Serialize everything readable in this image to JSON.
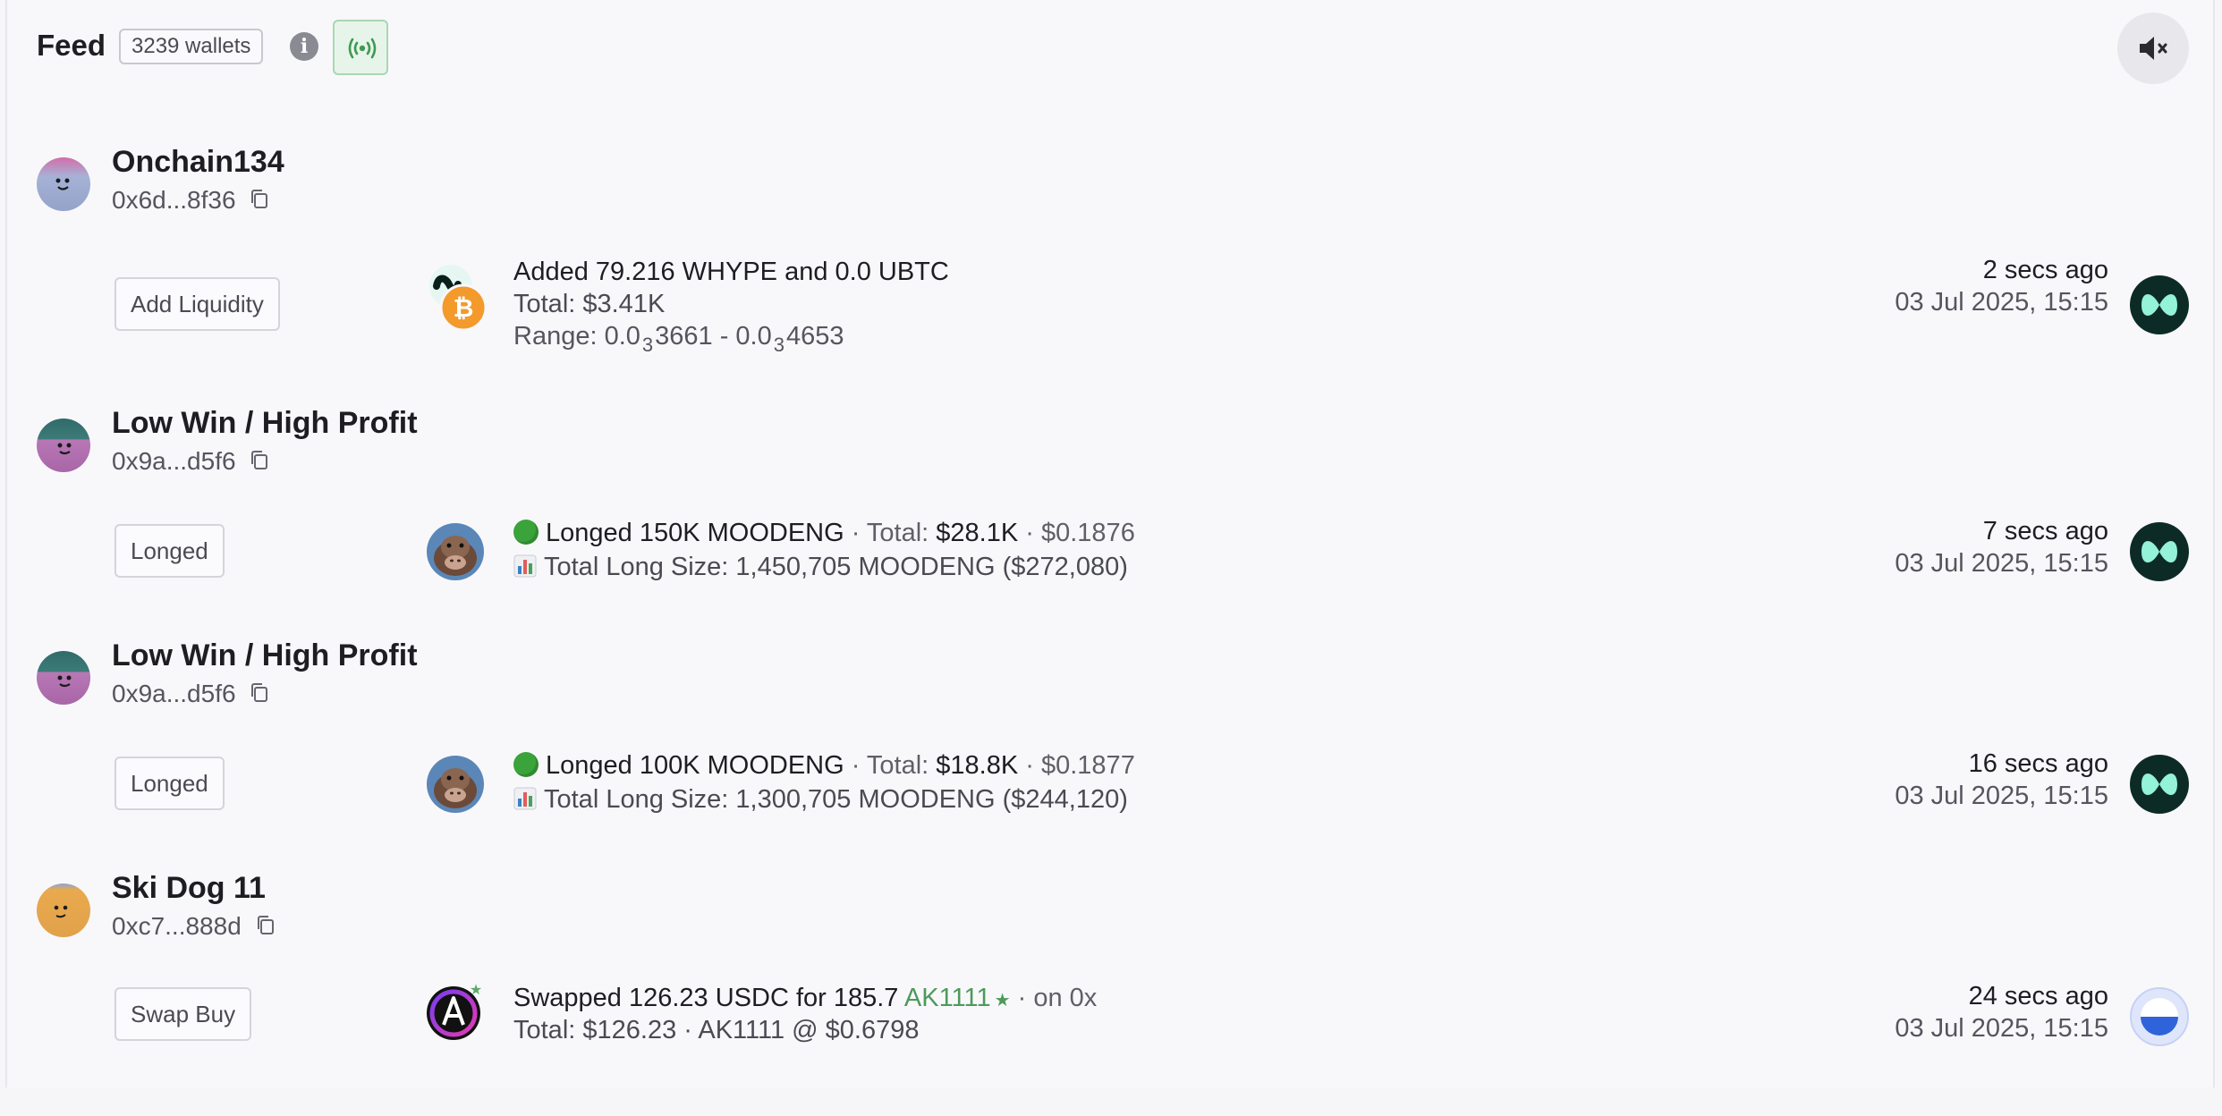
{
  "header": {
    "title": "Feed",
    "wallets_badge": "3239 wallets",
    "info_icon": "i"
  },
  "icons": {
    "info": "info-icon",
    "live": "broadcast-icon",
    "mute": "speaker-muted-icon",
    "copy": "copy-icon"
  },
  "colors": {
    "accent_green": "#4d9a5a",
    "live_bg": "#e7f4ea"
  },
  "feed": [
    {
      "name": "Onchain134",
      "address": "0x6d...8f36",
      "action": "Add Liquidity",
      "line1": "Added 79.216 WHYPE and 0.0 UBTC",
      "line2": "Total: $3.41K",
      "line3_prefix": "Range: 0.0",
      "line3_sub1": "3",
      "line3_mid": "3661 - 0.0",
      "line3_sub2": "3",
      "line3_end": "4653",
      "time_ago": "2 secs ago",
      "date": "03 Jul 2025, 15:15",
      "protocol": "hyperliquid-icon"
    },
    {
      "name": "Low Win / High Profit",
      "address": "0x9a...d5f6",
      "action": "Longed",
      "line1_main": "Longed 150K MOODENG",
      "line1_total_label": " · Total: ",
      "line1_total": "$28.1K",
      "line1_price": " · $0.1876",
      "line2": "Total Long Size: 1,450,705 MOODENG ($272,080)",
      "time_ago": "7 secs ago",
      "date": "03 Jul 2025, 15:15",
      "protocol": "hyperliquid-icon"
    },
    {
      "name": "Low Win / High Profit",
      "address": "0x9a...d5f6",
      "action": "Longed",
      "line1_main": "Longed 100K MOODENG",
      "line1_total_label": " · Total: ",
      "line1_total": "$18.8K",
      "line1_price": " · $0.1877",
      "line2": "Total Long Size: 1,300,705 MOODENG ($244,120)",
      "time_ago": "16 secs ago",
      "date": "03 Jul 2025, 15:15",
      "protocol": "hyperliquid-icon"
    },
    {
      "name": "Ski Dog 11",
      "address": "0xc7...888d",
      "action": "Swap Buy",
      "line1_main": "Swapped 126.23 USDC for 185.7 ",
      "line1_token": "AK1111",
      "line1_star": "★",
      "line1_end": " · on 0x",
      "line2": "Total: $126.23 · AK1111 @ $0.6798",
      "time_ago": "24 secs ago",
      "date": "03 Jul 2025, 15:15",
      "protocol": "0x-protocol-icon"
    }
  ]
}
